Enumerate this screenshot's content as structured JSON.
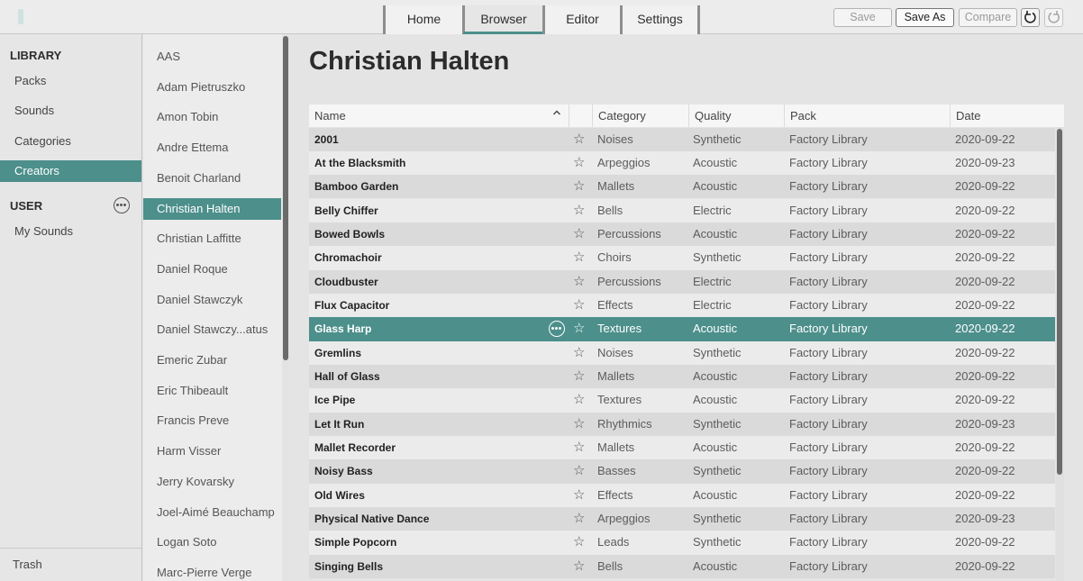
{
  "topbar": {
    "tabs": [
      {
        "label": "Home"
      },
      {
        "label": "Browser"
      },
      {
        "label": "Editor"
      },
      {
        "label": "Settings"
      }
    ],
    "active_tab": "Browser",
    "buttons": {
      "save": "Save",
      "save_as": "Save As",
      "compare": "Compare"
    },
    "icons": [
      "undo-icon",
      "redo-icon"
    ]
  },
  "sidebar": {
    "library_heading": "LIBRARY",
    "library_items": [
      {
        "label": "Packs"
      },
      {
        "label": "Sounds"
      },
      {
        "label": "Categories"
      },
      {
        "label": "Creators"
      }
    ],
    "active_item": "Creators",
    "user_heading": "USER",
    "user_items": [
      {
        "label": "My Sounds"
      }
    ],
    "trash_label": "Trash"
  },
  "creators": {
    "items": [
      {
        "label": "AAS"
      },
      {
        "label": "Adam Pietruszko"
      },
      {
        "label": "Amon Tobin"
      },
      {
        "label": "Andre Ettema"
      },
      {
        "label": "Benoit Charland"
      },
      {
        "label": "Christian Halten"
      },
      {
        "label": "Christian Laffitte"
      },
      {
        "label": "Daniel Roque"
      },
      {
        "label": "Daniel Stawczyk"
      },
      {
        "label": "Daniel Stawczy...atus"
      },
      {
        "label": "Emeric Zubar"
      },
      {
        "label": "Eric Thibeault"
      },
      {
        "label": "Francis Preve"
      },
      {
        "label": "Harm Visser"
      },
      {
        "label": "Jerry Kovarsky"
      },
      {
        "label": "Joel-Aimé Beauchamp"
      },
      {
        "label": "Logan Soto"
      },
      {
        "label": "Marc-Pierre Verge"
      }
    ],
    "active_item": "Christian Halten"
  },
  "main": {
    "title": "Christian Halten",
    "columns": {
      "name": "Name",
      "category": "Category",
      "quality": "Quality",
      "pack": "Pack",
      "date": "Date"
    },
    "sort_indicator": "^",
    "star_glyph": "☆",
    "rows": [
      {
        "name": "2001",
        "category": "Noises",
        "quality": "Synthetic",
        "pack": "Factory Library",
        "date": "2020-09-22"
      },
      {
        "name": "At the Blacksmith",
        "category": "Arpeggios",
        "quality": "Acoustic",
        "pack": "Factory Library",
        "date": "2020-09-23"
      },
      {
        "name": "Bamboo Garden",
        "category": "Mallets",
        "quality": "Acoustic",
        "pack": "Factory Library",
        "date": "2020-09-22"
      },
      {
        "name": "Belly Chiffer",
        "category": "Bells",
        "quality": "Electric",
        "pack": "Factory Library",
        "date": "2020-09-22"
      },
      {
        "name": "Bowed Bowls",
        "category": "Percussions",
        "quality": "Acoustic",
        "pack": "Factory Library",
        "date": "2020-09-22"
      },
      {
        "name": "Chromachoir",
        "category": "Choirs",
        "quality": "Synthetic",
        "pack": "Factory Library",
        "date": "2020-09-22"
      },
      {
        "name": "Cloudbuster",
        "category": "Percussions",
        "quality": "Electric",
        "pack": "Factory Library",
        "date": "2020-09-22"
      },
      {
        "name": "Flux Capacitor",
        "category": "Effects",
        "quality": "Electric",
        "pack": "Factory Library",
        "date": "2020-09-22"
      },
      {
        "name": "Glass Harp",
        "category": "Textures",
        "quality": "Acoustic",
        "pack": "Factory Library",
        "date": "2020-09-22"
      },
      {
        "name": "Gremlins",
        "category": "Noises",
        "quality": "Synthetic",
        "pack": "Factory Library",
        "date": "2020-09-22"
      },
      {
        "name": "Hall of Glass",
        "category": "Mallets",
        "quality": "Acoustic",
        "pack": "Factory Library",
        "date": "2020-09-22"
      },
      {
        "name": "Ice Pipe",
        "category": "Textures",
        "quality": "Acoustic",
        "pack": "Factory Library",
        "date": "2020-09-22"
      },
      {
        "name": "Let It Run",
        "category": "Rhythmics",
        "quality": "Synthetic",
        "pack": "Factory Library",
        "date": "2020-09-23"
      },
      {
        "name": "Mallet Recorder",
        "category": "Mallets",
        "quality": "Acoustic",
        "pack": "Factory Library",
        "date": "2020-09-22"
      },
      {
        "name": "Noisy Bass",
        "category": "Basses",
        "quality": "Synthetic",
        "pack": "Factory Library",
        "date": "2020-09-22"
      },
      {
        "name": "Old Wires",
        "category": "Effects",
        "quality": "Acoustic",
        "pack": "Factory Library",
        "date": "2020-09-22"
      },
      {
        "name": "Physical Native Dance",
        "category": "Arpeggios",
        "quality": "Synthetic",
        "pack": "Factory Library",
        "date": "2020-09-23"
      },
      {
        "name": "Simple Popcorn",
        "category": "Leads",
        "quality": "Synthetic",
        "pack": "Factory Library",
        "date": "2020-09-22"
      },
      {
        "name": "Singing Bells",
        "category": "Bells",
        "quality": "Acoustic",
        "pack": "Factory Library",
        "date": "2020-09-22"
      }
    ],
    "selected_row": "Glass Harp"
  },
  "colors": {
    "accent": "#4c8f8b",
    "row_dark": "#dadada",
    "row_light": "#ebebeb",
    "scrollbar": "#6b6b6b"
  }
}
